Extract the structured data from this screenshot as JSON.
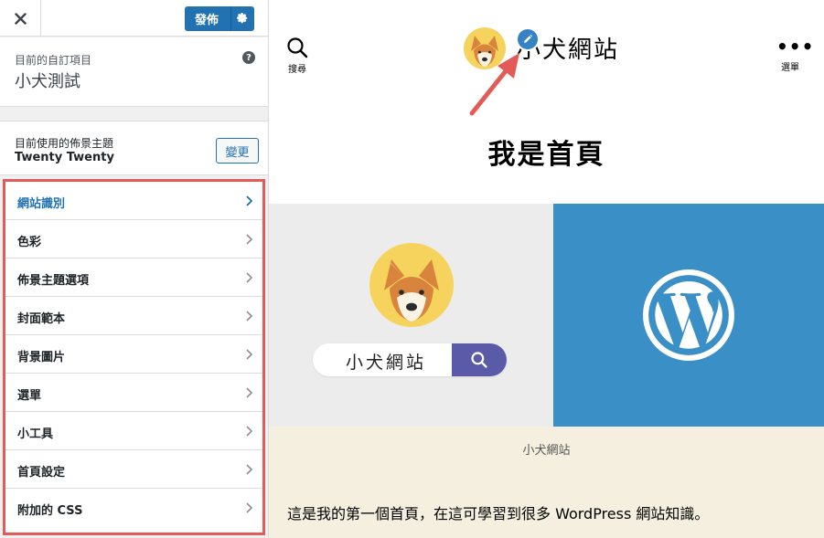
{
  "sidebar": {
    "close_label": "close",
    "publish_label": "發佈",
    "customizing": {
      "label": "目前的自訂項目",
      "title": "小犬測試",
      "help": "?"
    },
    "theme": {
      "label": "目前使用的佈景主題",
      "name": "Twenty Twenty",
      "change_label": "變更"
    },
    "panels": [
      {
        "label": "網站識別",
        "active": true
      },
      {
        "label": "色彩"
      },
      {
        "label": "佈景主題選項"
      },
      {
        "label": "封面範本"
      },
      {
        "label": "背景圖片"
      },
      {
        "label": "選單"
      },
      {
        "label": "小工具"
      },
      {
        "label": "首頁設定"
      },
      {
        "label": "附加的 CSS"
      }
    ]
  },
  "preview": {
    "search_label": "搜尋",
    "menu_label": "選單",
    "site_title": "小犬網站",
    "page_heading": "我是首頁",
    "cover_search_text": "小犬網站",
    "caption": "小犬網站",
    "body_text": "這是我的第一個首頁，在這可學習到很多 WordPress 網站知識。"
  },
  "colors": {
    "accent": "#2271b1",
    "highlight_border": "#e35b59",
    "wp_blue": "#3a8fc6",
    "caption_band": "#f5efe0"
  },
  "icons": {
    "close": "close-icon",
    "publish_settings": "gear-icon",
    "help": "help-icon",
    "chevron": "chevron-right-icon",
    "search": "search-icon",
    "menu": "ellipsis-icon",
    "edit": "pencil-icon",
    "wordpress": "wordpress-logo"
  }
}
